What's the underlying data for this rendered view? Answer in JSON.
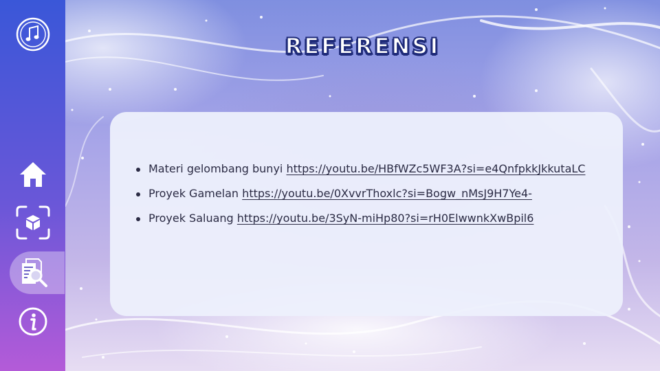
{
  "page": {
    "title": "REFERENSI"
  },
  "sidebar": {
    "items": [
      {
        "name": "music",
        "icon": "music-note-icon",
        "active": false
      },
      {
        "name": "home",
        "icon": "home-icon",
        "active": false
      },
      {
        "name": "ar-cube",
        "icon": "ar-cube-icon",
        "active": false
      },
      {
        "name": "reference",
        "icon": "document-search-icon",
        "active": true
      },
      {
        "name": "info",
        "icon": "info-icon",
        "active": false
      }
    ]
  },
  "references": [
    {
      "label": "Materi gelombang bunyi",
      "url": "https://youtu.be/HBfWZc5WF3A?si=e4QnfpkkJkkutaLC"
    },
    {
      "label": "Proyek Gamelan",
      "url": "https://youtu.be/0XvvrThoxlc?si=Bogw_nMsJ9H7Ye4-"
    },
    {
      "label": "Proyek Saluang",
      "url": "https://youtu.be/3SyN-miHp80?si=rH0ElwwnkXwBpil6"
    }
  ],
  "colors": {
    "sidebar_top": "#3a57d8",
    "sidebar_bottom": "#b45bd8",
    "title_outline": "#1e2a78",
    "card": "#edf0fc"
  }
}
